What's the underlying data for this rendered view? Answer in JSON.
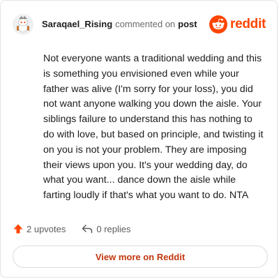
{
  "comment": {
    "author": "Saraqael_Rising",
    "action_text": "commented on",
    "target_text": "post",
    "body": "Not everyone wants a traditional wedding and this is something you envisioned even while your father was alive (I'm sorry for your loss), you did not want anyone walking you down the aisle. Your siblings failure to understand this has nothing to do with love, but based on principle, and twisting it on you is not your problem. They are imposing their views upon you. It's your wedding day, do what you want... dance down the aisle while farting loudly if that's what you want to do. NTA"
  },
  "brand": {
    "wordmark": "reddit",
    "icon": "reddit-logo-icon",
    "color": "#ff4500"
  },
  "actions": {
    "upvotes_label": "2 upvotes",
    "upvote_icon": "upvote-arrow-icon",
    "upvote_color": "#ff4500",
    "replies_label": "0 replies",
    "reply_icon": "reply-arrow-icon"
  },
  "footer": {
    "view_more_label": "View more on Reddit",
    "link_color": "#c2370e"
  }
}
